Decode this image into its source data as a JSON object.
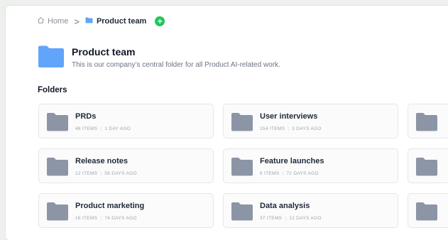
{
  "breadcrumb": {
    "home_label": "Home",
    "separator": ">",
    "current_label": "Product team",
    "add_symbol": "+"
  },
  "header": {
    "title": "Product team",
    "description": "This is our company’s central folder for all Product AI-related work."
  },
  "folders_section": {
    "title": "Folders",
    "items": [
      {
        "name": "PRDs",
        "items_count": "48 ITEMS",
        "updated": "1 DAY AGO"
      },
      {
        "name": "User interviews",
        "items_count": "154 ITEMS",
        "updated": "3 DAYS AGO"
      },
      {
        "name": "Release notes",
        "items_count": "12 ITEMS",
        "updated": "56 DAYS AGO"
      },
      {
        "name": "Feature launches",
        "items_count": "6 ITEMS",
        "updated": "72 DAYS AGO"
      },
      {
        "name": "Product marketing",
        "items_count": "16 ITEMS",
        "updated": "74 DAYS AGO"
      },
      {
        "name": "Data analysis",
        "items_count": "37 ITEMS",
        "updated": "12 DAYS AGO"
      }
    ]
  },
  "colors": {
    "folder_blue": "#60a5fa",
    "folder_gray": "#8b95a5",
    "add_green": "#22c55e"
  },
  "icons": {
    "home": "home-icon",
    "folder": "folder-icon",
    "add": "plus-icon"
  }
}
